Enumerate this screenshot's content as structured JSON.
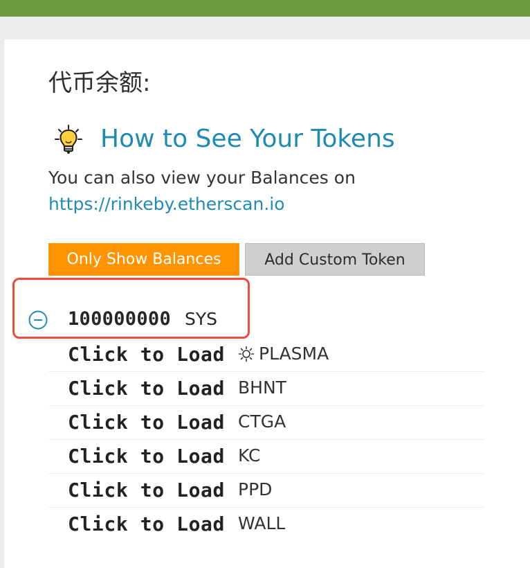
{
  "section": {
    "title": "代币余额:"
  },
  "help": {
    "icon": "lightbulb-icon",
    "link_text": "How to See Your Tokens"
  },
  "description": {
    "line": "You can also view your Balances on",
    "link_text": "https://rinkeby.etherscan.io"
  },
  "buttons": {
    "only_show_balances": "Only Show Balances",
    "add_custom_token": "Add Custom Token"
  },
  "highlighted_token": {
    "amount": "100000000",
    "symbol": "SYS",
    "icon": "minus-circle-icon"
  },
  "tokens": [
    {
      "action": "Click to Load",
      "symbol": "PLASMA",
      "icon": "sun-icon"
    },
    {
      "action": "Click to Load",
      "symbol": "BHNT"
    },
    {
      "action": "Click to Load",
      "symbol": "CTGA"
    },
    {
      "action": "Click to Load",
      "symbol": "KC"
    },
    {
      "action": "Click to Load",
      "symbol": "PPD"
    },
    {
      "action": "Click to Load",
      "symbol": "WALL"
    }
  ],
  "colors": {
    "top_bar": "#6b9a3f",
    "link": "#1f8bb1",
    "primary_button": "#ff9400",
    "secondary_button": "#cfcfcf",
    "highlight_outline": "#ef4b3a"
  }
}
